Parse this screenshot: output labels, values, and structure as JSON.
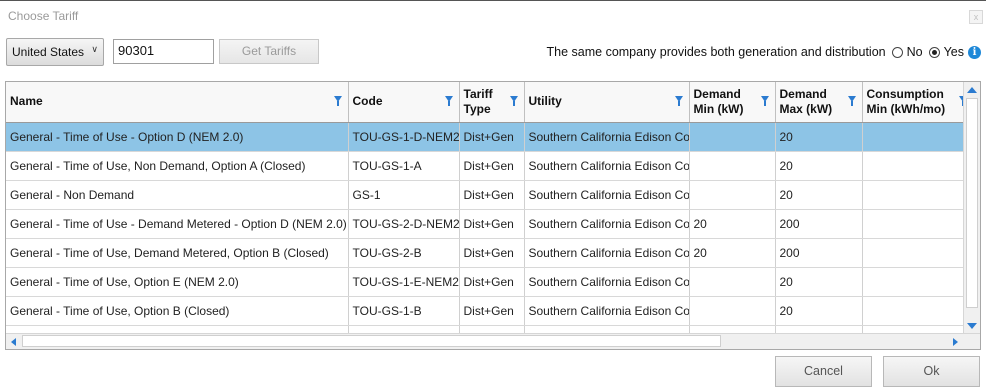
{
  "window": {
    "title": "Choose Tariff",
    "close_label": "x"
  },
  "toolbar": {
    "country": "United States",
    "zip": "90301",
    "get_tariffs_label": "Get Tariffs",
    "same_company_label": "The same company provides both generation and distribution",
    "option_no": "No",
    "option_yes": "Yes",
    "selected_option": "Yes"
  },
  "table": {
    "columns": [
      {
        "label": "Name"
      },
      {
        "label": "Code"
      },
      {
        "label": "Tariff Type"
      },
      {
        "label": "Utility"
      },
      {
        "label": "Demand Min (kW)"
      },
      {
        "label": "Demand Max (kW)"
      },
      {
        "label": "Consumption Min (kWh/mo)"
      }
    ],
    "rows": [
      {
        "name": "General - Time of Use - Option D (NEM 2.0)",
        "code": "TOU-GS-1-D-NEM2",
        "type": "Dist+Gen",
        "utility": "Southern California Edison Co",
        "dmin": "",
        "dmax": "20",
        "cmin": ""
      },
      {
        "name": "General - Time of Use, Non Demand, Option A (Closed)",
        "code": "TOU-GS-1-A",
        "type": "Dist+Gen",
        "utility": "Southern California Edison Co",
        "dmin": "",
        "dmax": "20",
        "cmin": ""
      },
      {
        "name": "General - Non Demand",
        "code": "GS-1",
        "type": "Dist+Gen",
        "utility": "Southern California Edison Co",
        "dmin": "",
        "dmax": "20",
        "cmin": ""
      },
      {
        "name": "General - Time of Use - Demand Metered - Option D (NEM 2.0)",
        "code": "TOU-GS-2-D-NEM2",
        "type": "Dist+Gen",
        "utility": "Southern California Edison Co",
        "dmin": "20",
        "dmax": "200",
        "cmin": ""
      },
      {
        "name": "General - Time of Use, Demand Metered, Option B (Closed)",
        "code": "TOU-GS-2-B",
        "type": "Dist+Gen",
        "utility": "Southern California Edison Co",
        "dmin": "20",
        "dmax": "200",
        "cmin": ""
      },
      {
        "name": "General - Time of Use, Option E (NEM 2.0)",
        "code": "TOU-GS-1-E-NEM2",
        "type": "Dist+Gen",
        "utility": "Southern California Edison Co",
        "dmin": "",
        "dmax": "20",
        "cmin": ""
      },
      {
        "name": "General - Time of Use, Option B (Closed)",
        "code": "TOU-GS-1-B",
        "type": "Dist+Gen",
        "utility": "Southern California Edison Co",
        "dmin": "",
        "dmax": "20",
        "cmin": ""
      },
      {
        "name": "",
        "code": "",
        "type": "",
        "utility": "",
        "dmin": "",
        "dmax": "",
        "cmin": ""
      }
    ],
    "selected_row": 0
  },
  "footer": {
    "cancel_label": "Cancel",
    "ok_label": "Ok"
  },
  "colors": {
    "accent": "#2b7bd0",
    "selection": "#8dc4e6",
    "info": "#1e88d8"
  },
  "icons": {
    "filter": "filter-icon",
    "info": "info-icon",
    "close": "close-icon"
  }
}
